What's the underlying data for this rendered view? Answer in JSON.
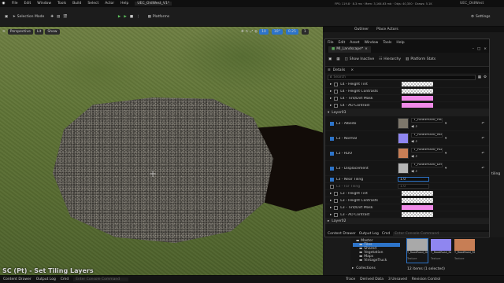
{
  "menu": [
    "File",
    "Edit",
    "Window",
    "Tools",
    "Build",
    "Select",
    "Actor",
    "Help"
  ],
  "app_tab": "UEC_OldWest_V1*",
  "top_right": {
    "stats": "FPS: 119.8  ·  8.3 ms  ·  Mem: 3,164.63 mb  ·  Objs: 40,350  ·  Draws: 5.1K",
    "project": "UEC_OldWest"
  },
  "toolbar": {
    "mode": "Selection Mode",
    "platforms": "Platforms",
    "settings": "Settings"
  },
  "viewport": {
    "perspective": "Perspective",
    "lit": "Lit",
    "show": "Show",
    "snap_grid": "10",
    "snap_rot": "10°",
    "snap_scale": "0.25",
    "camera": "1",
    "label": "SC (Pt) - Set Tiling Layers"
  },
  "outliner": {
    "tab": "Outliner",
    "place_actors": "Place Actors"
  },
  "editor": {
    "menu": [
      "File",
      "Edit",
      "Asset",
      "Window",
      "Tools",
      "Help"
    ],
    "doc_tab": "MI_Landscape*",
    "toolbar": {
      "show_inactive": "Show Inactive",
      "hierarchy": "Hierarchy",
      "platform_stats": "Platform Stats"
    },
    "details_tab": "Details",
    "search_placeholder": "Search",
    "upper_rows": [
      {
        "label": "L4 - Height Tint",
        "swatch": "checker"
      },
      {
        "label": "L4 - Height Contrasts",
        "swatch": "checker"
      },
      {
        "label": "L4 - Tint/Dirt Mask",
        "swatch": "#f08ae8"
      },
      {
        "label": "L4 - AO Contrast",
        "swatch": "#f08ae8"
      }
    ],
    "layer_group": "Layer03",
    "layer_rows": [
      {
        "label": "L3 - Albedo",
        "tex": "T_RoadRoad_Albedo",
        "thumb": "#7d776b",
        "checked": true
      },
      {
        "label": "L3 - Normal",
        "tex": "T_RoadRoad_Normal",
        "thumb": "#8f86f0",
        "checked": true
      },
      {
        "label": "L3 - RDO",
        "tex": "T_RoadRoad_RDO",
        "thumb": "#c77e55",
        "checked": true
      },
      {
        "label": "L3 - Displacement",
        "tex": "T_RoadRoad_Displacement",
        "thumb": "#b5b5b5",
        "checked": true
      }
    ],
    "tiling_rows": [
      {
        "label": "L3 - Near Tiling",
        "value": "1.0",
        "checked": true
      },
      {
        "label": "L3 - Far Tiling",
        "value": "1.0",
        "checked": false
      }
    ],
    "lower_rows": [
      {
        "label": "L3 - Height Tint",
        "swatch": "checker"
      },
      {
        "label": "L3 - Height Contrasts",
        "swatch": "checker"
      },
      {
        "label": "L3 - Tint/Dirt Mask",
        "swatch": "#f08ae8"
      },
      {
        "label": "L3 - AO Contrast",
        "swatch": "checker"
      }
    ],
    "next_group": "Layer02",
    "bottom": {
      "content_drawer": "Content Drawer",
      "output_log": "Output Log",
      "cmd": "Cmd",
      "console_placeholder": "Enter Console Command"
    }
  },
  "right_side": {
    "setting_label": "tiling"
  },
  "content": {
    "folders": [
      "Master",
      "Tiles",
      "Shared",
      "Vegetation",
      "Maps",
      "VintageTruck"
    ],
    "tiles": [
      {
        "name": "T_RoadRoad_Displacement",
        "kind": "Texture",
        "color": "#a9a9a9"
      },
      {
        "name": "T_RoadRoad_Normal",
        "kind": "Texture",
        "color": "#8f86f0"
      },
      {
        "name": "T_RoadRoad_RDO",
        "kind": "Texture",
        "color": "#c77e55"
      }
    ],
    "status": "12 items (1 selected)",
    "collections": "Collections"
  },
  "statusbar": {
    "content_drawer": "Content Drawer",
    "output_log": "Output Log",
    "cmd": "Cmd",
    "console_placeholder": "Enter Console Command",
    "trace": "Trace",
    "derived_data": "Derived Data",
    "unsaved": "3 Unsaved",
    "revision": "Revision Control"
  }
}
